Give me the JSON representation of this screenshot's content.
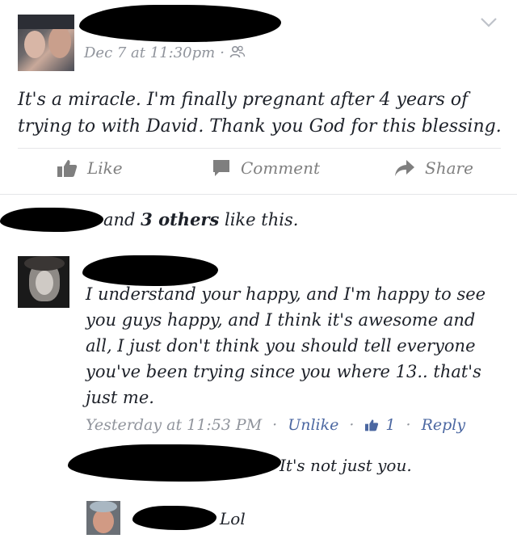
{
  "post": {
    "timestamp": "Dec 7 at 11:30pm",
    "separator": "·",
    "body": "It's a miracle. I'm finally pregnant after 4 years of trying to with David. Thank you God for this blessing."
  },
  "actions": {
    "like": "Like",
    "comment": "Comment",
    "share": "Share"
  },
  "likes": {
    "prefix": "and ",
    "others": "3 others",
    "suffix": " like this."
  },
  "comments": [
    {
      "text": "I understand your happy, and I'm happy to see you guys happy, and I think it's awesome and all, I just don't think you should tell everyone you've been trying since you where 13.. that's just me.",
      "timestamp": "Yesterday at 11:53 PM",
      "unlike": "Unlike",
      "like_count": "1",
      "reply": "Reply",
      "separator": "·"
    }
  ],
  "replies": [
    {
      "text": "It's not just you."
    },
    {
      "text": "Lol"
    }
  ],
  "colors": {
    "link": "#4b67a1",
    "meta": "#90949c",
    "action": "#7f7f7f",
    "redaction": "#000000"
  }
}
